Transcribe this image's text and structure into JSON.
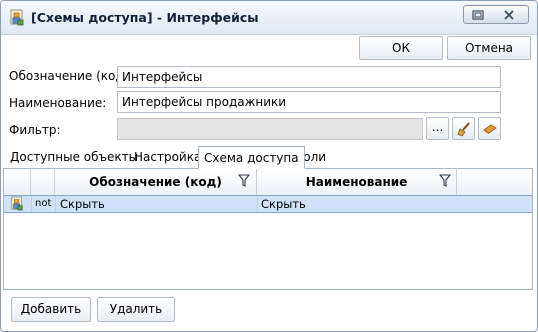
{
  "window": {
    "title": "[Схемы доступа] - Интерфейсы",
    "icon": "access-scheme-icon"
  },
  "actions": {
    "ok_label": "ОК",
    "cancel_label": "Отмена",
    "add_label": "Добавить",
    "delete_label": "Удалить"
  },
  "form": {
    "code_label": "Обозначение (код):",
    "code_value": "Интерфейсы",
    "name_label": "Наименование:",
    "name_value": "Интерфейсы продажники",
    "filter_label": "Фильтр:",
    "filter_value": "",
    "filter_browse_label": "...",
    "filter_clear_icon": "broom-icon",
    "filter_apply_icon": "eraser-icon"
  },
  "tabs": [
    {
      "label": "Доступные объекты",
      "active": false
    },
    {
      "label": "Настройка",
      "active": false
    },
    {
      "label": "Схема доступа",
      "active": true
    },
    {
      "label": "Роли",
      "active": false
    }
  ],
  "grid": {
    "columns": [
      "Обозначение (код)",
      "Наименование"
    ],
    "rows": [
      {
        "flag": "not",
        "code": "Скрыть",
        "name": "Скрыть",
        "selected": true
      }
    ]
  },
  "colors": {
    "selection": "#cfe2f8",
    "border": "#a9b6c8"
  }
}
